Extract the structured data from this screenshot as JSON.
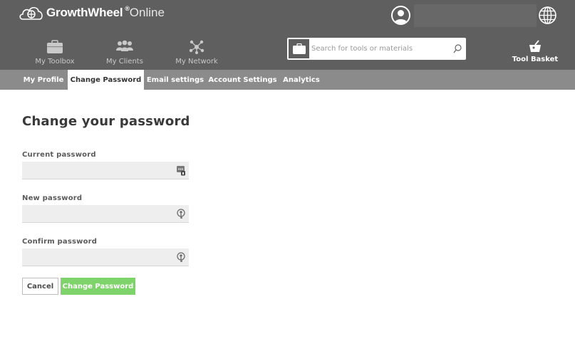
{
  "app": {
    "brand": "GrowthWheel",
    "brand_mark": "®",
    "brand_suffix": "Online"
  },
  "colors": {
    "header_bg": "#5f5f5f",
    "subnav_bg": "#8b8b8b",
    "primary_button": "#7ed36a"
  },
  "header": {
    "nav": [
      {
        "label": "My Toolbox",
        "icon": "briefcase-icon"
      },
      {
        "label": "My Clients",
        "icon": "clients-icon"
      },
      {
        "label": "My Network",
        "icon": "network-icon"
      }
    ],
    "search": {
      "placeholder": "Search for tools or materials",
      "value": ""
    },
    "basket_label": "Tool Basket"
  },
  "subnav": {
    "tabs": [
      {
        "label": "My Profile",
        "active": false
      },
      {
        "label": "Change Password",
        "active": true
      },
      {
        "label": "Email settings",
        "active": false
      },
      {
        "label": "Account Settings",
        "active": false
      },
      {
        "label": "Analytics",
        "active": false
      }
    ]
  },
  "form": {
    "title": "Change your password",
    "fields": [
      {
        "label": "Current password",
        "value": "",
        "icon": "password-manager-icon"
      },
      {
        "label": "New password",
        "value": "",
        "icon": "key-icon"
      },
      {
        "label": "Confirm password",
        "value": "",
        "icon": "key-icon"
      }
    ],
    "cancel_label": "Cancel",
    "submit_label": "Change Password"
  }
}
